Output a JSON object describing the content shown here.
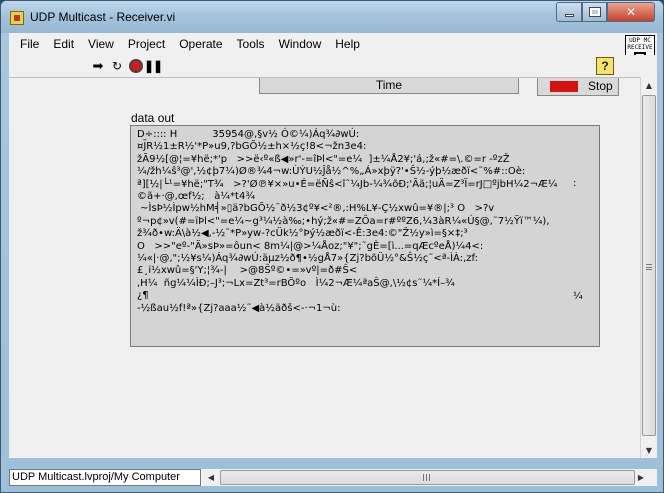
{
  "window": {
    "title": "UDP Multicast - Receiver.vi",
    "controls": {
      "minimize": "min",
      "maximize": "max",
      "close": "x"
    }
  },
  "menubar": {
    "items": [
      "File",
      "Edit",
      "View",
      "Project",
      "Operate",
      "Tools",
      "Window",
      "Help"
    ]
  },
  "vi_icon": {
    "line1": "UDP MC",
    "line2": "RECEIVE"
  },
  "toolbar": {
    "run_glyph": "➡",
    "continuous_glyph": "↻",
    "pause_glyph": "❚❚",
    "help_glyph": "?"
  },
  "panel": {
    "time_label": "Time",
    "stop_label": "Stop",
    "data_out_label": "data out",
    "data_out_lines": [
      "D÷:::: H           35954@,§v½ Ó©¼)Áq¾∂wÚ:",
      "¤J̄R½1±R½'*P»u9,?bGÕ½±h×½ç!8<¬žn3e4:",
      "žÃ9½[@¦=¥hë;*'p   >>ë‹º«ß◀»r'-=îÞl<\"=e¼  ]±¼Å2¥;'á,;ž«#=\\.©=r -ºzŽ",
      "¼/žh¼ŝ³@',½¢þ7¼)Ø®¾4¬w:ÙÝU½Ĵå½^%„Á»xþÿ?'•Ŝ½-ýþ½æðï<˜%#::Oè:",
      "ª][½|└¹=¥hë;\"T¾   >?'Ø℗¥×»u•É=ëÑŝ<î˜¼Јb-¼¾õÐ;'Ãã;¦uÄ=Z³Ï=rJ□ºjbH¼2¬Æ¼",
      "©ã+·@,œf½;   à¼*t4¾",
      " ~ÌsÞ½Ìpw½hM╡»▯ä?bGÕ½¯ð½3¢º¥<²®,:H%L¥-Ç½xwû=¥®|;³ O   >?v",
      "º¬p¢»v(#=ïÞl<\"=e¼~g³¼½à‰;•hý;ž«#=ZÔa=r#ººZ6,¼3àR¼«Ú§@,˜7½Ÿï™¼),",
      "ž¾ð•w:Ä\\à½◀,-½˜*P»yw-?cÜk½°Þý½æðï<-Ê:3e4:©\"Ž½y»ì=§×‡;³",
      "O   >>\"eº-\"Ä»sÞ»=ôun< 8m¼|@>¼Åoz;\"¥\";˜gÈ=[ì...=qÆcºeÅ)¼4<:",
      "¼«|·@,\";½¥s¼)Áq¾∂wÚ:äµz½ð¶•½gÅ7»{Zj?bõÜ½°&Ŝ½ç˜<ª-ÌÀ:,zf:",
      "£¸i½xwû=§'Y;¦¾-|    >@8Ŝº©•=»vº|=ð#Ŝ<",
      ",H¼  ñg¼¼ÌÐ;–J³;¬Lx=Zt³=rBÕºo   Ì¼2¬Æ¼ªaŜ@,\\½¢s˜¼*Í–¾",
      "¿¶",
      "-½ßau½f!ª»{Zj?aaa½˜◀à½äðš<-·¬1¬ù:"
    ],
    "data_out_extra": ":",
    "data_out_extra2": "¼"
  },
  "statusbar": {
    "project_path": "UDP Multicast.lvproj/My Computer",
    "left_arrow": "◀",
    "right_arrow": "▶"
  },
  "scrollbar": {
    "up_arrow": "▲",
    "down_arrow": "▼"
  }
}
